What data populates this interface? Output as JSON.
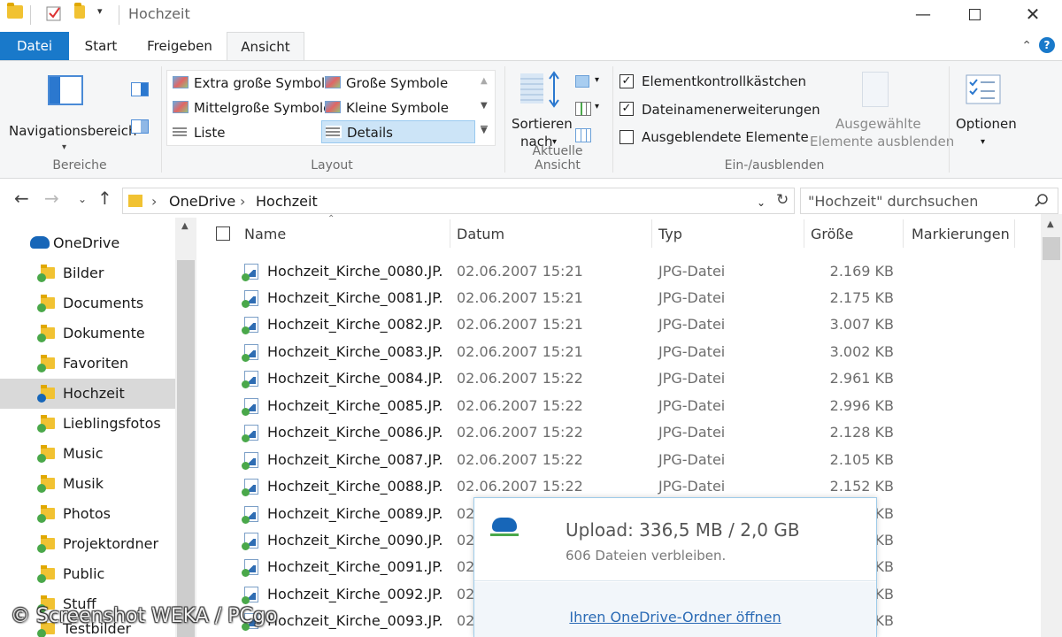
{
  "window": {
    "title": "Hochzeit"
  },
  "ribbon_tabs": [
    {
      "label": "Datei"
    },
    {
      "label": "Start"
    },
    {
      "label": "Freigeben"
    },
    {
      "label": "Ansicht"
    }
  ],
  "ribbon": {
    "bereiche": {
      "nav_pane_label": "Navigationsbereich",
      "group_label": "Bereiche"
    },
    "layout": {
      "items": [
        "Extra große Symbole",
        "Große Symbole",
        "Mittelgroße Symbole",
        "Kleine Symbole",
        "Liste",
        "Details"
      ],
      "selected": "Details",
      "group_label": "Layout"
    },
    "current_view": {
      "sort_label_1": "Sortieren",
      "sort_label_2": "nach",
      "group_label": "Aktuelle Ansicht"
    },
    "show_hide": {
      "checkboxes": [
        {
          "label": "Elementkontrollkästchen",
          "checked": true
        },
        {
          "label": "Dateinamenerweiterungen",
          "checked": true
        },
        {
          "label": "Ausgeblendete Elemente",
          "checked": false
        }
      ],
      "hide_selected_1": "Ausgewählte",
      "hide_selected_2": "Elemente ausblenden",
      "group_label": "Ein-/ausblenden"
    },
    "options_label": "Optionen"
  },
  "address": {
    "crumbs": [
      "OneDrive",
      "Hochzeit"
    ],
    "search_placeholder": "\"Hochzeit\" durchsuchen"
  },
  "nav_pane": {
    "root": "OneDrive",
    "items": [
      "Bilder",
      "Documents",
      "Dokumente",
      "Favoriten",
      "Hochzeit",
      "Lieblingsfotos",
      "Music",
      "Musik",
      "Photos",
      "Projektordner",
      "Public",
      "Stuff",
      "Testbilder"
    ],
    "selected": "Hochzeit"
  },
  "columns": {
    "name": "Name",
    "date": "Datum",
    "type": "Typ",
    "size": "Größe",
    "tags": "Markierungen"
  },
  "files": [
    {
      "name": "Hochzeit_Kirche_0080.JP...",
      "date": "02.06.2007 15:21",
      "type": "JPG-Datei",
      "size": "2.169 KB"
    },
    {
      "name": "Hochzeit_Kirche_0081.JP...",
      "date": "02.06.2007 15:21",
      "type": "JPG-Datei",
      "size": "2.175 KB"
    },
    {
      "name": "Hochzeit_Kirche_0082.JP...",
      "date": "02.06.2007 15:21",
      "type": "JPG-Datei",
      "size": "3.007 KB"
    },
    {
      "name": "Hochzeit_Kirche_0083.JP...",
      "date": "02.06.2007 15:21",
      "type": "JPG-Datei",
      "size": "3.002 KB"
    },
    {
      "name": "Hochzeit_Kirche_0084.JP...",
      "date": "02.06.2007 15:22",
      "type": "JPG-Datei",
      "size": "2.961 KB"
    },
    {
      "name": "Hochzeit_Kirche_0085.JP...",
      "date": "02.06.2007 15:22",
      "type": "JPG-Datei",
      "size": "2.996 KB"
    },
    {
      "name": "Hochzeit_Kirche_0086.JP...",
      "date": "02.06.2007 15:22",
      "type": "JPG-Datei",
      "size": "2.128 KB"
    },
    {
      "name": "Hochzeit_Kirche_0087.JP...",
      "date": "02.06.2007 15:22",
      "type": "JPG-Datei",
      "size": "2.105 KB"
    },
    {
      "name": "Hochzeit_Kirche_0088.JP...",
      "date": "02.06.2007 15:22",
      "type": "JPG-Datei",
      "size": "2.152 KB"
    },
    {
      "name": "Hochzeit_Kirche_0089.JP...",
      "date": "02",
      "type": "",
      "size": "KB"
    },
    {
      "name": "Hochzeit_Kirche_0090.JP...",
      "date": "02",
      "type": "",
      "size": "KB"
    },
    {
      "name": "Hochzeit_Kirche_0091.JP...",
      "date": "02",
      "type": "",
      "size": "KB"
    },
    {
      "name": "Hochzeit_Kirche_0092.JP...",
      "date": "02",
      "type": "",
      "size": "KB"
    },
    {
      "name": "Hochzeit_Kirche_0093.JP...",
      "date": "02",
      "type": "",
      "size": "KB"
    }
  ],
  "popup": {
    "title": "Upload: 336,5 MB / 2,0 GB",
    "subtitle": "606 Dateien verbleiben.",
    "link": "Ihren OneDrive-Ordner öffnen"
  },
  "watermark": "© Screenshot WEKA / PCgo",
  "colors": {
    "accent": "#1979ca",
    "selection": "#cce4f7",
    "sync_ok": "#4aa84a",
    "link": "#2b6bb5"
  }
}
